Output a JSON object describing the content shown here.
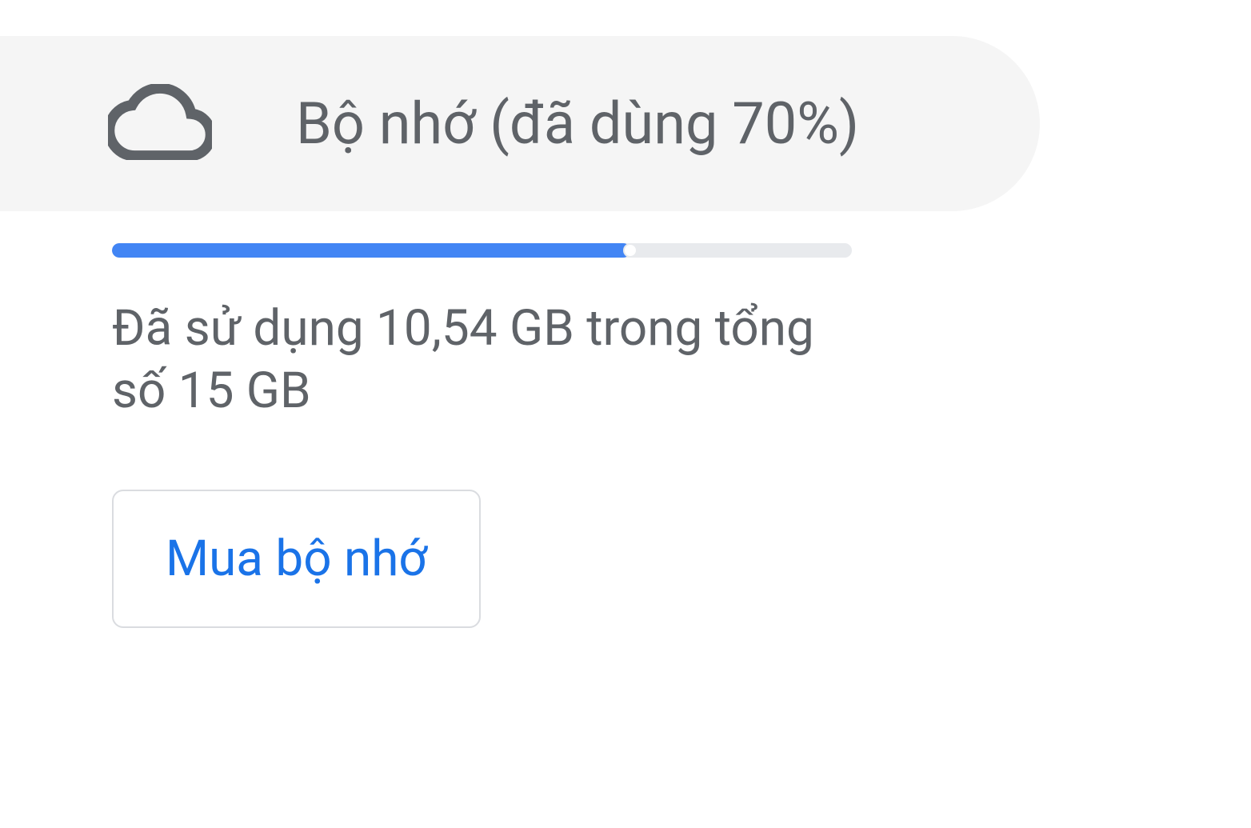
{
  "storage": {
    "title": "Bộ nhớ (đã dùng 70%)",
    "usage_percent": 70,
    "usage_text": "Đã sử dụng 10,54 GB trong tổng số 15 GB",
    "buy_button_label": "Mua bộ nhớ"
  }
}
